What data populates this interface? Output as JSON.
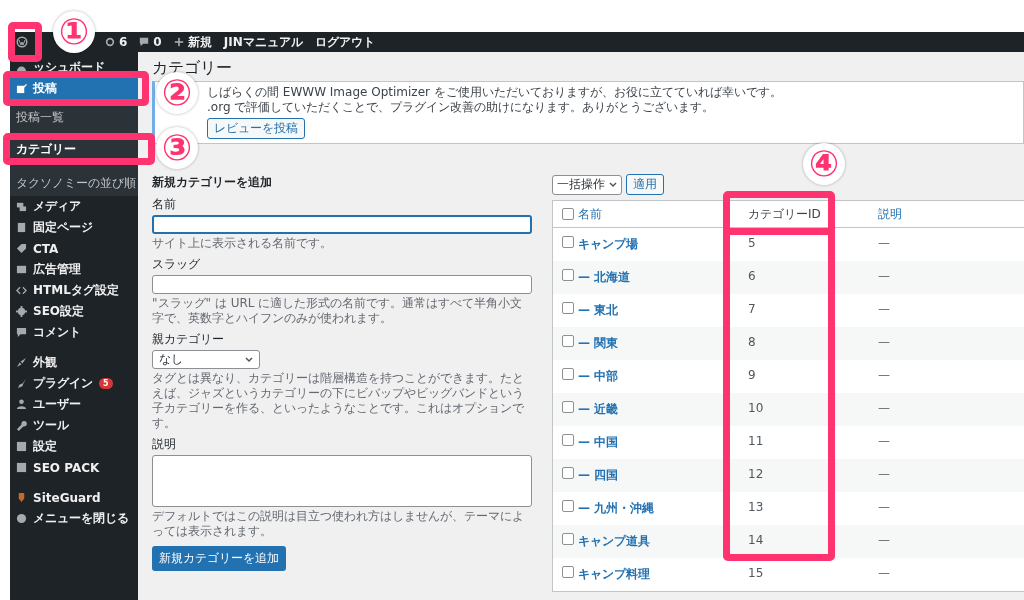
{
  "admin_bar": {
    "items": [
      {
        "label": "6",
        "kind": "updates"
      },
      {
        "label": "0",
        "kind": "comments"
      },
      {
        "label": "新規",
        "kind": "new"
      },
      {
        "label": "JINマニュアル",
        "kind": "text"
      },
      {
        "label": "ログアウト",
        "kind": "text"
      }
    ]
  },
  "sidebar": {
    "groups": [
      [
        {
          "label": "ッシュボード",
          "selected": false
        },
        {
          "label": "投稿",
          "selected": true,
          "submenu": [
            {
              "label": "投稿一覧",
              "selected": false
            },
            {
              "label": "カテゴリー",
              "selected": true
            },
            {
              "label": "タクソノミーの並び順",
              "selected": false
            }
          ]
        },
        {
          "label": "メディア",
          "selected": false
        },
        {
          "label": "固定ページ",
          "selected": false
        },
        {
          "label": "CTA",
          "selected": false
        },
        {
          "label": "広告管理",
          "selected": false
        },
        {
          "label": "HTMLタグ設定",
          "selected": false
        },
        {
          "label": "SEO設定",
          "selected": false
        },
        {
          "label": "コメント",
          "selected": false
        }
      ],
      [
        {
          "label": "外観",
          "selected": false
        },
        {
          "label": "プラグイン",
          "selected": false,
          "badge": "5"
        },
        {
          "label": "ユーザー",
          "selected": false
        },
        {
          "label": "ツール",
          "selected": false
        },
        {
          "label": "設定",
          "selected": false
        },
        {
          "label": "SEO PACK",
          "selected": false
        }
      ],
      [
        {
          "label": "SiteGuard",
          "selected": false
        },
        {
          "label": "メニューを閉じる",
          "selected": false
        }
      ]
    ]
  },
  "page_title": "カテゴリー",
  "notice": {
    "line1": "しばらくの間 EWWW Image Optimizer をご使用いただいておりますが、お役に立てていれば幸いです。",
    "line2": ".org で評価していただくことで、プラグイン改善の助けになります。ありがとうございます。",
    "button": "レビューを投稿"
  },
  "form": {
    "heading": "新規カテゴリーを追加",
    "fields": [
      {
        "kind": "input",
        "label": "名前",
        "focused": true,
        "hint": "サイト上に表示される名前です。"
      },
      {
        "kind": "input",
        "label": "スラッグ",
        "focused": false,
        "hint": "\"スラッグ\" は URL に適した形式の名前です。通常はすべて半角小文字で、英数字とハイフンのみが使われます。"
      },
      {
        "kind": "select",
        "label": "親カテゴリー",
        "value": "なし",
        "hint": "タグとは異なり、カテゴリーは階層構造を持つことができます。たとえば、ジャズというカテゴリーの下にビバップやビッグバンドという子カテゴリーを作る、といったようなことです。これはオプションです。"
      },
      {
        "kind": "textarea",
        "label": "説明",
        "hint": "デフォルトではこの説明は目立つ使われ方はしませんが、テーマによっては表示されます。"
      }
    ],
    "submit": "新規カテゴリーを追加"
  },
  "table": {
    "bulk_action": "一括操作",
    "apply": "適用",
    "select_all_checked": false,
    "columns": [
      "名前",
      "カテゴリーID",
      "説明"
    ],
    "rows": [
      {
        "name": "キャンプ場",
        "id": "5",
        "description": "—",
        "checked": false
      },
      {
        "name": "— 北海道",
        "id": "6",
        "description": "—",
        "checked": false
      },
      {
        "name": "— 東北",
        "id": "7",
        "description": "—",
        "checked": false
      },
      {
        "name": "— 関東",
        "id": "8",
        "description": "—",
        "checked": false
      },
      {
        "name": "— 中部",
        "id": "9",
        "description": "—",
        "checked": false
      },
      {
        "name": "— 近畿",
        "id": "10",
        "description": "—",
        "checked": false
      },
      {
        "name": "— 中国",
        "id": "11",
        "description": "—",
        "checked": false
      },
      {
        "name": "— 四国",
        "id": "12",
        "description": "—",
        "checked": false
      },
      {
        "name": "— 九州・沖縄",
        "id": "13",
        "description": "—",
        "checked": false
      },
      {
        "name": "キャンプ道具",
        "id": "14",
        "description": "—",
        "checked": false
      },
      {
        "name": "キャンプ料理",
        "id": "15",
        "description": "—",
        "checked": false
      }
    ]
  },
  "annotations": [
    {
      "label": "①"
    },
    {
      "label": "②"
    },
    {
      "label": "③"
    },
    {
      "label": "④"
    }
  ]
}
